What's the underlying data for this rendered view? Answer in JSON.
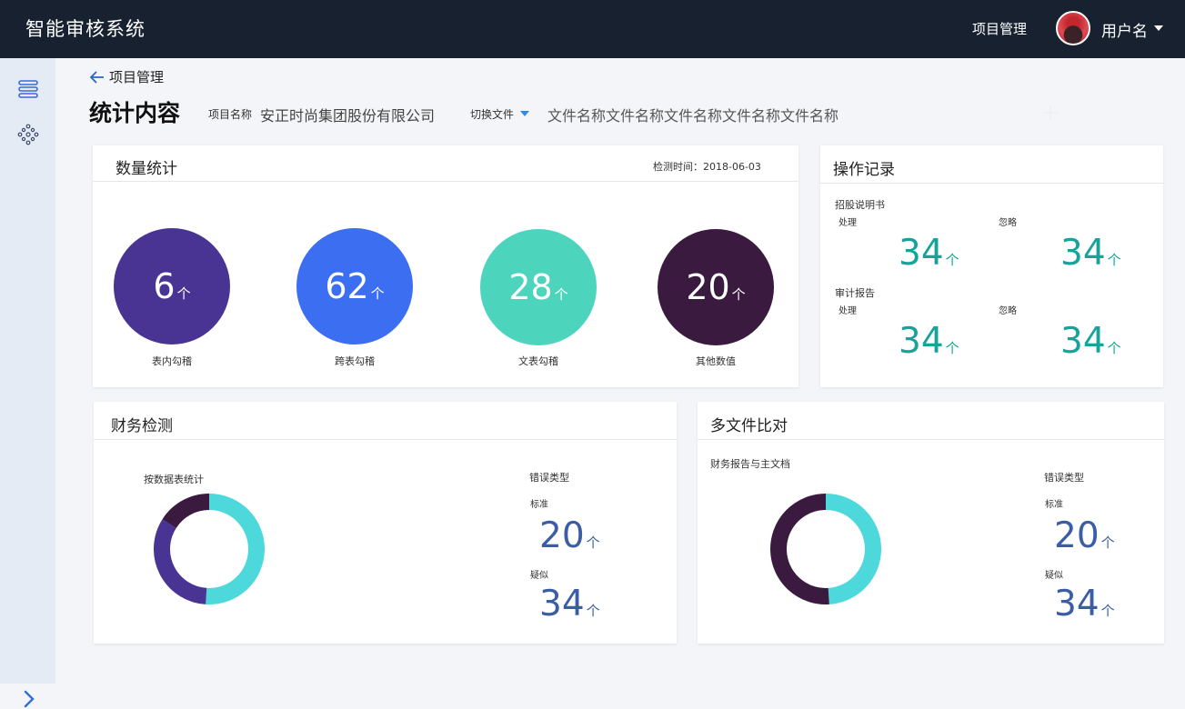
{
  "header": {
    "app_title": "智能审核系统",
    "nav_item": "项目管理",
    "username": "用户名"
  },
  "sidebar": {
    "icons": [
      "stack-icon",
      "network-icon"
    ],
    "expand_icon": "chevron-right-icon"
  },
  "breadcrumb": {
    "back_label": "项目管理"
  },
  "page": {
    "title": "统计内容",
    "project_label": "项目名称",
    "project_name": "安正时尚集团股份有限公司",
    "switch_label": "切换文件",
    "file_name": "文件名称文件名称文件名称文件名称文件名称"
  },
  "quantity": {
    "title": "数量统计",
    "detect_time": "检测时间：2018-06-03",
    "items": [
      {
        "value": "6",
        "unit": "个",
        "label": "表内勾稽",
        "color": "#4a3493"
      },
      {
        "value": "62",
        "unit": "个",
        "label": "跨表勾稽",
        "color": "#3b6ef0"
      },
      {
        "value": "28",
        "unit": "个",
        "label": "文表勾稽",
        "color": "#4dd4bc"
      },
      {
        "value": "20",
        "unit": "个",
        "label": "其他数值",
        "color": "#3a1a3f"
      }
    ]
  },
  "operations": {
    "title": "操作记录",
    "groups": [
      {
        "name": "招股说明书",
        "handle_label": "处理",
        "handle_value": "34",
        "ignore_label": "忽略",
        "ignore_value": "34",
        "unit": "个"
      },
      {
        "name": "审计报告",
        "handle_label": "处理",
        "handle_value": "34",
        "ignore_label": "忽略",
        "ignore_value": "34",
        "unit": "个"
      }
    ]
  },
  "finance": {
    "title": "财务检测",
    "chart_label": "按数据表统计",
    "error_type": "错误类型",
    "standard_label": "标准",
    "standard_value": "20",
    "similar_label": "疑似",
    "similar_value": "34",
    "unit": "个"
  },
  "multifile": {
    "title": "多文件比对",
    "chart_label": "财务报告与主文档",
    "error_type": "错误类型",
    "standard_label": "标准",
    "standard_value": "20",
    "similar_label": "疑似",
    "similar_value": "34",
    "unit": "个"
  },
  "chart_data": [
    {
      "type": "pie",
      "donut": true,
      "segments": [
        {
          "value": 0.51,
          "color": "#4dd8db"
        },
        {
          "value": 0.33,
          "color": "#4a3493"
        },
        {
          "value": 0.16,
          "color": "#3a1a3f"
        }
      ]
    },
    {
      "type": "pie",
      "donut": true,
      "segments": [
        {
          "value": 0.49,
          "color": "#4dd8db"
        },
        {
          "value": 0.51,
          "color": "#3a1a3f"
        }
      ]
    }
  ]
}
